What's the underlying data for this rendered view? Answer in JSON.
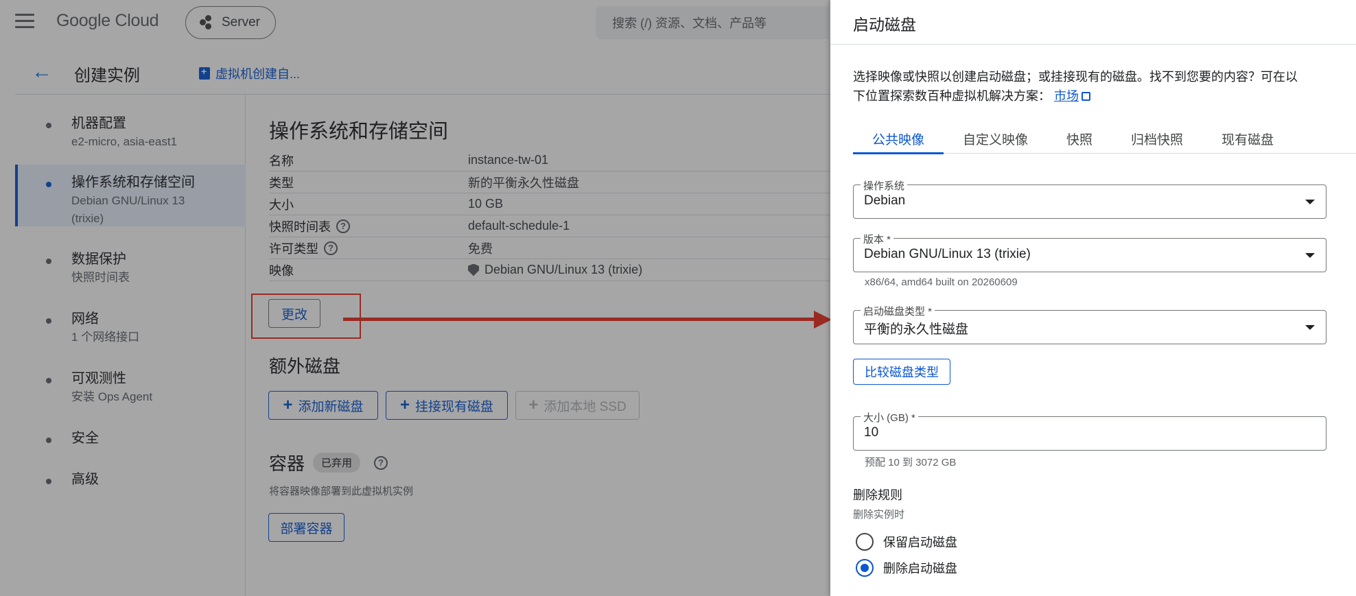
{
  "topbar": {
    "logo": "Google Cloud",
    "project": "Server",
    "search_placeholder": "搜索 (/) 资源、文档、产品等"
  },
  "subheader": {
    "title": "创建实例",
    "vm_link": "虚拟机创建自..."
  },
  "nav": [
    {
      "title": "机器配置",
      "subtitle": "e2-micro, asia-east1"
    },
    {
      "title": "操作系统和存储空间",
      "subtitle": "Debian GNU/Linux 13 (trixie)"
    },
    {
      "title": "数据保护",
      "subtitle": "快照时间表"
    },
    {
      "title": "网络",
      "subtitle": "1 个网络接口"
    },
    {
      "title": "可观测性",
      "subtitle": "安装 Ops Agent"
    },
    {
      "title": "安全",
      "subtitle": ""
    },
    {
      "title": "高级",
      "subtitle": ""
    }
  ],
  "os_storage": {
    "title": "操作系统和存储空间",
    "rows": [
      {
        "key": "名称",
        "value": "instance-tw-01"
      },
      {
        "key": "类型",
        "value": "新的平衡永久性磁盘"
      },
      {
        "key": "大小",
        "value": "10 GB"
      },
      {
        "key": "快照时间表",
        "value": "default-schedule-1"
      },
      {
        "key": "许可类型",
        "value": "免费"
      },
      {
        "key": "映像",
        "value": "Debian GNU/Linux 13 (trixie)"
      }
    ],
    "change_button": "更改"
  },
  "extra_disks": {
    "title": "额外磁盘",
    "add_new": "添加新磁盘",
    "attach_existing": "挂接现有磁盘",
    "add_local_ssd": "添加本地 SSD"
  },
  "container": {
    "title": "容器",
    "badge": "已弃用",
    "description": "将容器映像部署到此虚拟机实例",
    "deploy_button": "部署容器"
  },
  "panel": {
    "title": "启动磁盘",
    "description_line1": "选择映像或快照以创建启动磁盘；或挂接现有的磁盘。找不到您要的内容？可在以",
    "description_line2": "下位置探索数百种虚拟机解决方案：",
    "marketplace_link": "市场",
    "tabs": [
      "公共映像",
      "自定义映像",
      "快照",
      "归档快照",
      "现有磁盘"
    ],
    "os_label": "操作系统",
    "os_value": "Debian",
    "version_label": "版本 *",
    "version_value": "Debian GNU/Linux 13 (trixie)",
    "version_hint": "x86/64, amd64 built on 20260609",
    "disk_type_label": "启动磁盘类型 *",
    "disk_type_value": "平衡的永久性磁盘",
    "compare_button": "比较磁盘类型",
    "size_label": "大小 (GB) *",
    "size_value": "10",
    "size_hint": "预配 10 到 3072 GB",
    "deletion_title": "删除规则",
    "deletion_subtitle": "删除实例时",
    "keep_option": "保留启动磁盘",
    "delete_option": "删除启动磁盘",
    "selected_option": "删除启动磁盘"
  },
  "colors": {
    "accent": "#0b57d0",
    "annotation": "#ea3323"
  }
}
